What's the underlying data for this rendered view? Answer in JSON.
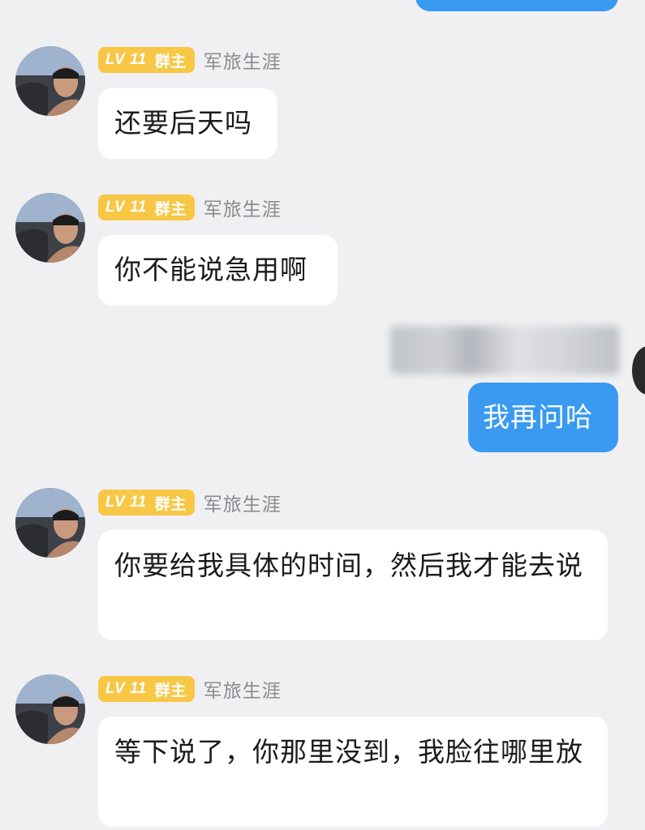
{
  "messages": [
    {
      "badge_level": "LV 11",
      "badge_role": "群主",
      "nickname": "军旅生涯",
      "text": "还要后天吗",
      "avatar_icon": "person-photo-avatar"
    },
    {
      "badge_level": "LV 11",
      "badge_role": "群主",
      "nickname": "军旅生涯",
      "text": "你不能说急用啊",
      "avatar_icon": "person-photo-avatar"
    },
    {
      "text": "我再问哈",
      "sender_name_blurred": true
    },
    {
      "badge_level": "LV 11",
      "badge_role": "群主",
      "nickname": "军旅生涯",
      "text": "你要给我具体的时间，然后我才能去说",
      "avatar_icon": "person-photo-avatar"
    },
    {
      "badge_level": "LV 11",
      "badge_role": "群主",
      "nickname": "军旅生涯",
      "text": "等下说了，你那里没到，我脸往哪里放",
      "avatar_icon": "person-photo-avatar"
    }
  ],
  "colors": {
    "background": "#f0f0f2",
    "sent_bubble": "#3a9af2",
    "received_bubble": "#ffffff",
    "badge": "#f7c745",
    "nickname": "#8a8a8e"
  }
}
